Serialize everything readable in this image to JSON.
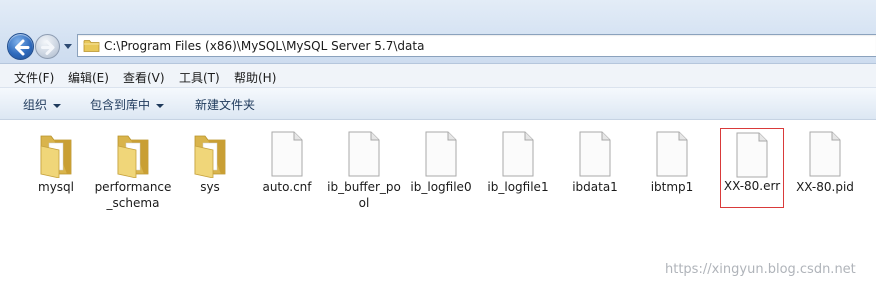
{
  "address_bar": {
    "path": "C:\\Program Files (x86)\\MySQL\\MySQL Server 5.7\\data",
    "back_icon": "back-arrow-icon",
    "forward_icon": "forward-arrow-icon",
    "folder_icon": "folder-icon"
  },
  "menu": [
    {
      "label": "文件(F)",
      "key": "file"
    },
    {
      "label": "编辑(E)",
      "key": "edit"
    },
    {
      "label": "查看(V)",
      "key": "view"
    },
    {
      "label": "工具(T)",
      "key": "tools"
    },
    {
      "label": "帮助(H)",
      "key": "help"
    }
  ],
  "commands": {
    "organize": "组织",
    "include_in_library": "包含到库中",
    "new_folder": "新建文件夹"
  },
  "files": [
    {
      "name": "mysql",
      "type": "folder",
      "selected": false
    },
    {
      "name": "performance_schema",
      "type": "folder",
      "selected": false
    },
    {
      "name": "sys",
      "type": "folder",
      "selected": false
    },
    {
      "name": "auto.cnf",
      "type": "file",
      "selected": false
    },
    {
      "name": "ib_buffer_pool",
      "type": "file",
      "selected": false
    },
    {
      "name": "ib_logfile0",
      "type": "file",
      "selected": false
    },
    {
      "name": "ib_logfile1",
      "type": "file",
      "selected": false
    },
    {
      "name": "ibdata1",
      "type": "file",
      "selected": false
    },
    {
      "name": "ibtmp1",
      "type": "file",
      "selected": false
    },
    {
      "name": "XX-80.err",
      "type": "file",
      "selected": true
    },
    {
      "name": "XX-80.pid",
      "type": "file",
      "selected": false
    }
  ],
  "watermark": "https://xingyun.blog.csdn.net",
  "colors": {
    "highlight_border": "#d93a3a",
    "folder_yellow": "#e8c85a",
    "command_text": "#1e395b"
  }
}
